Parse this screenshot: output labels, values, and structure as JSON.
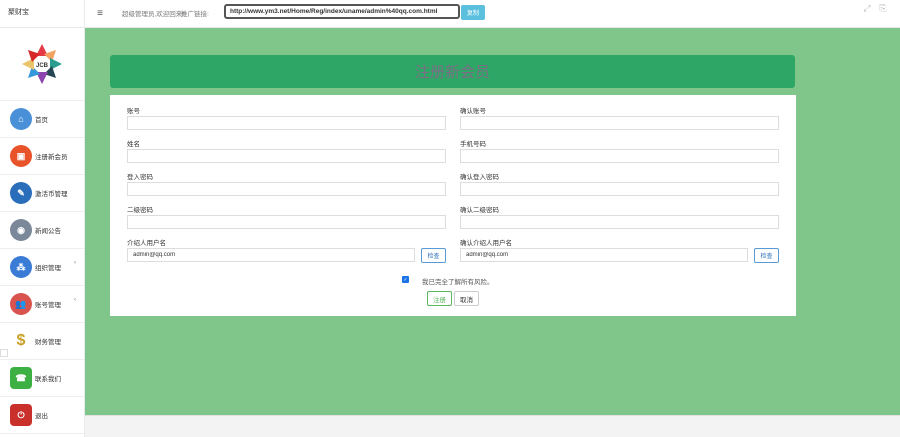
{
  "header": {
    "brand": "聚财宝",
    "welcome": "超级管理员,欢迎回来!",
    "promo_label": "推广链接:",
    "promo_url": "http://www.ym3.net/Home/Reg/index/uname/admin%40qq.com.html",
    "copy_label": "复制"
  },
  "sidebar": {
    "items": [
      {
        "label": "首页",
        "icon": "house-icon",
        "color": "#4a90d9"
      },
      {
        "label": "注册新会员",
        "icon": "lock-icon",
        "color": "#e8532a"
      },
      {
        "label": "激活币管理",
        "icon": "pen-icon",
        "color": "#2a6ebb"
      },
      {
        "label": "新闻公告",
        "icon": "eye-icon",
        "color": "#7a8899"
      },
      {
        "label": "组织管理",
        "icon": "network-icon",
        "color": "#3a7bd5"
      },
      {
        "label": "账号管理",
        "icon": "users-icon",
        "color": "#d9534f"
      },
      {
        "label": "财务管理",
        "icon": "dollar-icon",
        "color": "#c8a02a"
      },
      {
        "label": "联系我们",
        "icon": "phone-icon",
        "color": "#3cb043"
      },
      {
        "label": "退出",
        "icon": "exit-icon",
        "color": "#c9302c"
      }
    ]
  },
  "form": {
    "title": "注册新会员",
    "account_label": "账号",
    "confirm_account_label": "确认账号",
    "name_label": "姓名",
    "phone_label": "手机号码",
    "login_pwd_label": "登入密码",
    "confirm_login_pwd_label": "确认登入密码",
    "second_pwd_label": "二级密码",
    "confirm_second_pwd_label": "确认二级密码",
    "referrer_label": "介绍人用户名",
    "confirm_referrer_label": "确认介绍人用户名",
    "referrer_value": "admin@qq.com",
    "confirm_referrer_value": "admin@qq.com",
    "check_label": "检查",
    "agree_text": "我已完全了解所有风险。",
    "submit_label": "注册",
    "cancel_label": "取消"
  }
}
